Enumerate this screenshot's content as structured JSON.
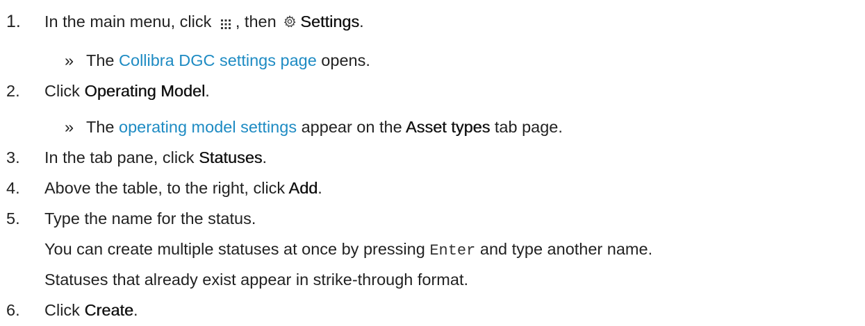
{
  "steps": [
    {
      "number": "1.",
      "parts": {
        "a": "In the main menu, click ",
        "b": ", then ",
        "c": "Settings",
        "d": "."
      },
      "icons": {
        "menu": "grid-menu-icon",
        "settings": "gear-icon"
      },
      "result": {
        "marker": "»",
        "pre": "The ",
        "link": "Collibra DGC settings page",
        "post": " opens."
      }
    },
    {
      "number": "2.",
      "parts": {
        "a": "Click ",
        "b": "Operating Model",
        "c": "."
      },
      "result": {
        "marker": "»",
        "pre": "The ",
        "link": "operating model settings",
        "mid": " appear on the ",
        "bold": "Asset types",
        "post": " tab page."
      }
    },
    {
      "number": "3.",
      "parts": {
        "a": "In the tab pane, click ",
        "b": "Statuses",
        "c": "."
      }
    },
    {
      "number": "4.",
      "parts": {
        "a": "Above the table, to the right, click ",
        "b": "Add",
        "c": "."
      }
    },
    {
      "number": "5.",
      "parts": {
        "a": "Type the name for the status."
      },
      "notes": [
        {
          "pre": "You can create multiple statuses at once by pressing ",
          "code": "Enter",
          "post": " and type another name."
        },
        {
          "pre": "Statuses that already exist appear in strike-through format."
        }
      ]
    },
    {
      "number": "6.",
      "parts": {
        "a": "Click ",
        "b": "Create",
        "c": "."
      }
    }
  ],
  "colors": {
    "link": "#1e8bc3",
    "text": "#222222"
  }
}
